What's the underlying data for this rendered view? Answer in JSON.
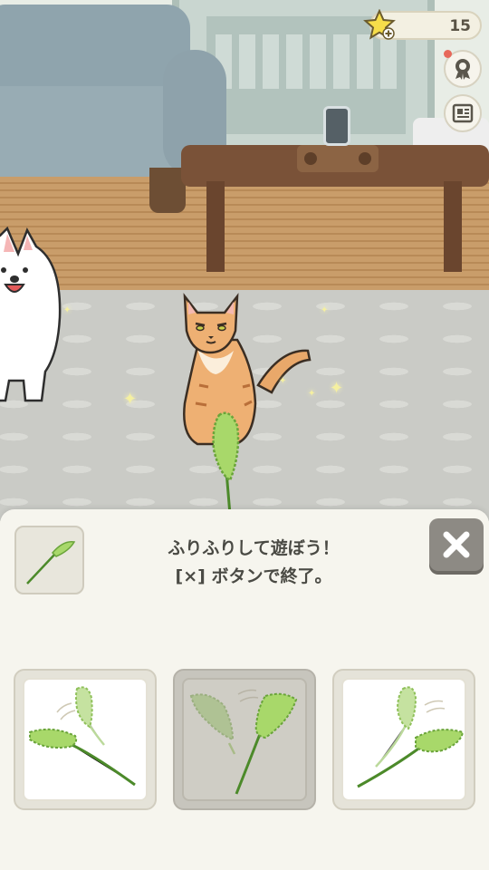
{
  "hud": {
    "star_count": "15",
    "star_icon": "star-plus-icon",
    "side_buttons": [
      {
        "icon": "ribbon-badge-icon",
        "has_notification": true
      },
      {
        "icon": "newspaper-icon",
        "has_notification": false
      }
    ]
  },
  "panel": {
    "message_line1": "ふりふりして遊ぼう！",
    "message_line2": "[×] ボタンで終了。",
    "current_item_icon": "foxtail-toy-icon",
    "close_icon": "close-x-icon",
    "motions": [
      {
        "icon": "swing-down-left-icon",
        "selected": false
      },
      {
        "icon": "swing-up-icon",
        "selected": true
      },
      {
        "icon": "swing-down-right-icon",
        "selected": false
      }
    ]
  },
  "colors": {
    "accent_green": "#a8d86a",
    "stem_green": "#4c8a2a",
    "star_yellow": "#f6dd4a",
    "close_button": "#8d8a84"
  }
}
